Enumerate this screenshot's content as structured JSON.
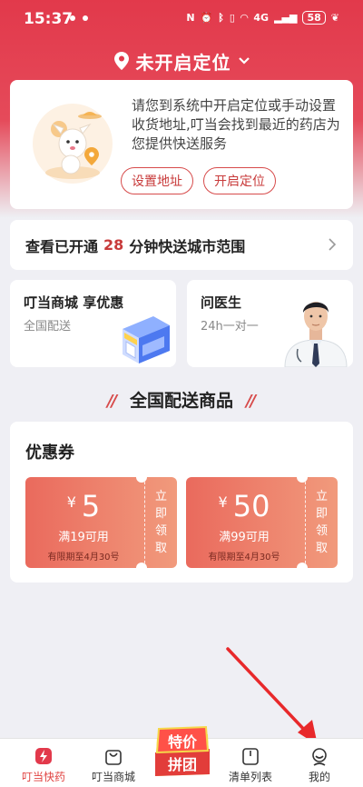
{
  "status_bar": {
    "time": "15:37",
    "network": "4G",
    "battery": "58"
  },
  "location_header": {
    "title": "未开启定位"
  },
  "location_card": {
    "message": "请您到系统中开启定位或手动设置收货地址,叮当会找到最近的药店为您提供快送服务",
    "set_address_label": "设置地址",
    "enable_location_label": "开启定位"
  },
  "city_banner": {
    "prefix": "查看已开通",
    "minutes": "28",
    "suffix": "分钟快送城市范围"
  },
  "quick_cards": [
    {
      "title": "叮当商城 享优惠",
      "subtitle": "全国配送"
    },
    {
      "title": "问医生",
      "subtitle": "24h一对一"
    }
  ],
  "section_title": "全国配送商品",
  "coupons": {
    "title": "优惠券",
    "currency": "¥",
    "items": [
      {
        "value": "5",
        "condition": "满19可用",
        "expiry": "有限期至4月30号",
        "claim": [
          "立",
          "即",
          "领",
          "取"
        ]
      },
      {
        "value": "50",
        "condition": "满99可用",
        "expiry": "有限期至4月30号",
        "claim": [
          "立",
          "即",
          "领",
          "取"
        ]
      }
    ]
  },
  "promo_badge": {
    "line1": "特价",
    "line2": "拼团"
  },
  "tabbar": [
    {
      "label": "叮当快药",
      "icon": "lightning-bag-icon",
      "active": true
    },
    {
      "label": "叮当商城",
      "icon": "shopping-bag-icon",
      "active": false
    },
    {
      "label": "清单列表",
      "icon": "list-icon",
      "active": false
    },
    {
      "label": "我的",
      "icon": "profile-icon",
      "active": false
    }
  ],
  "colors": {
    "brand_red": "#e2394b",
    "accent_red": "#c83a3a",
    "coupon_start": "#ea6a5d",
    "coupon_end": "#f19a7c",
    "arrow": "#e8292b"
  }
}
